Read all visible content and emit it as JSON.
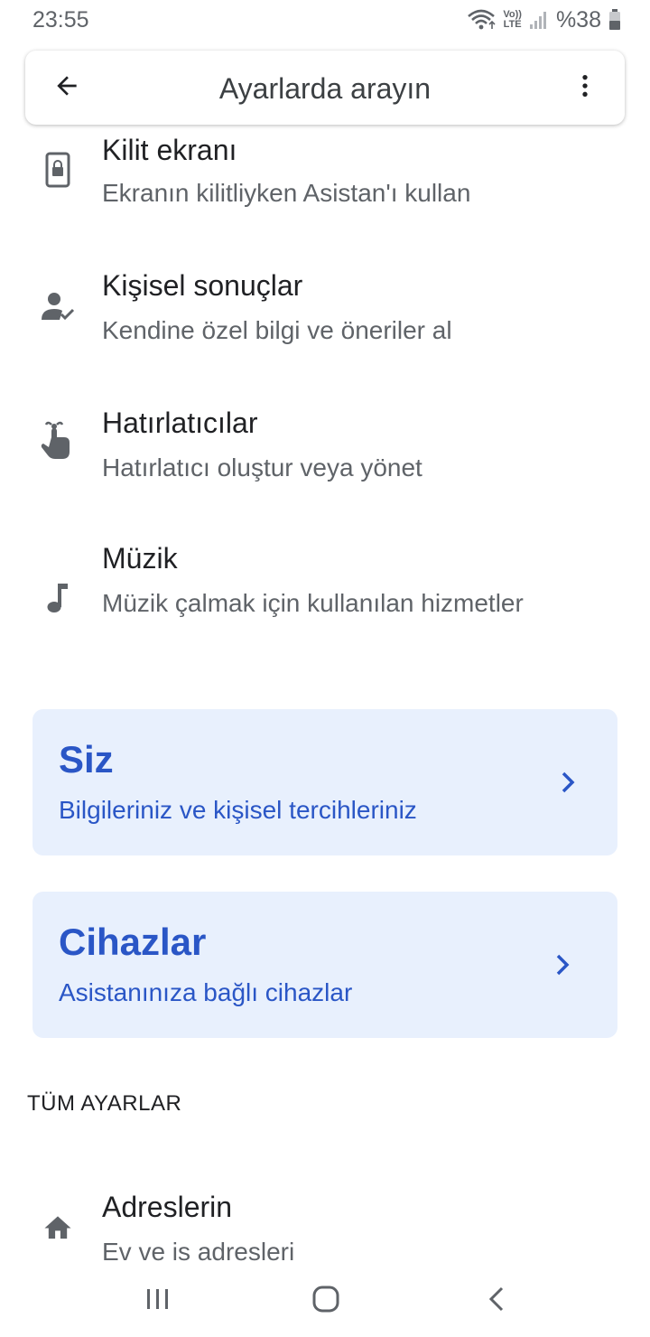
{
  "status_bar": {
    "time": "23:55",
    "volte_top": "Vo))",
    "volte_bottom": "LTE",
    "battery_text": "%38",
    "icons": [
      "wifi-icon",
      "volte-icon",
      "signal-icon",
      "battery-icon"
    ]
  },
  "search": {
    "placeholder": "Ayarlarda arayın",
    "back_icon": "back-arrow-icon",
    "more_icon": "more-vert-icon"
  },
  "settings": [
    {
      "icon": "lock-screen-icon",
      "title": "Kilit ekranı",
      "subtitle": "Ekranın kilitliyken Asistan'ı kullan"
    },
    {
      "icon": "personal-results-icon",
      "title": "Kişisel sonuçlar",
      "subtitle": "Kendine özel bilgi ve öneriler al"
    },
    {
      "icon": "reminder-icon",
      "title": "Hatırlatıcılar",
      "subtitle": "Hatırlatıcı oluştur veya yönet"
    },
    {
      "icon": "music-note-icon",
      "title": "Müzik",
      "subtitle": "Müzik çalmak için kullanılan hizmetler"
    }
  ],
  "cards": [
    {
      "title": "Siz",
      "subtitle": "Bilgileriniz ve kişisel tercihleriniz"
    },
    {
      "title": "Cihazlar",
      "subtitle": "Asistanınıza bağlı cihazlar"
    }
  ],
  "all_settings": {
    "header": "TÜM AYARLAR",
    "items": [
      {
        "icon": "home-icon",
        "title": "Adreslerin",
        "subtitle": "Ev ve is adresleri"
      }
    ]
  },
  "nav_bar": {
    "icons": [
      "recents-icon",
      "home-button-icon",
      "back-nav-icon"
    ]
  },
  "colors": {
    "card_background": "#e8f0fd",
    "accent_blue": "#2a56c6",
    "icon_gray": "#5f6368"
  }
}
